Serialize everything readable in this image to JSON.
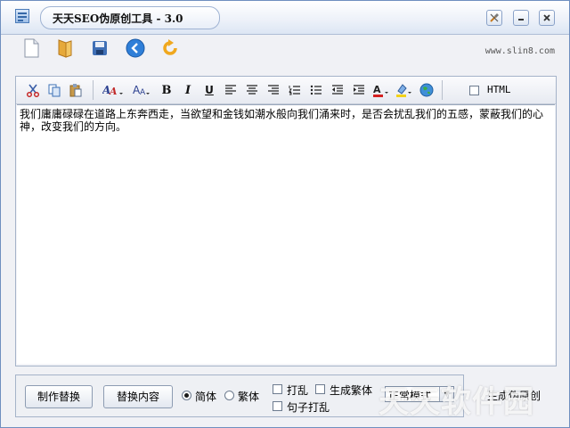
{
  "window": {
    "title": "天天SEO伪原创工具 - 3.0",
    "controls": [
      "settings-icon",
      "minimize-icon",
      "close-icon"
    ]
  },
  "toolbar": {
    "buttons": [
      "new-file-icon",
      "open-folder-icon",
      "save-icon",
      "back-icon",
      "refresh-icon"
    ],
    "site": "www.slin8.com"
  },
  "format_toolbar": {
    "buttons": [
      "cut-icon",
      "copy-icon",
      "paste-icon",
      "font-name-icon",
      "font-size-icon",
      "bold-icon",
      "italic-icon",
      "underline-icon",
      "align-left-icon",
      "align-center-icon",
      "align-right-icon",
      "ordered-list-icon",
      "bullet-list-icon",
      "outdent-icon",
      "indent-icon",
      "font-color-icon",
      "highlight-icon",
      "globe-link-icon"
    ],
    "bold": "B",
    "italic": "I",
    "underline": "U",
    "html_label": "HTML",
    "html_checked": false
  },
  "editor": {
    "content": "我们庸庸碌碌在道路上东奔西走，当欲望和金钱如潮水般向我们涌来时，是否会扰乱我们的五感，蒙蔽我们的心神，改变我们的方向。"
  },
  "bottom": {
    "make_replace": "制作替换",
    "replace_content": "替换内容",
    "simplified": "简体",
    "traditional": "繁体",
    "simplified_selected": true,
    "shuffle": "打乱",
    "generate_traditional": "生成繁体",
    "sentence_shuffle": "句子打乱",
    "mode": "正常模式",
    "generate": "生成伪原创",
    "watermark": "天天软件园"
  },
  "colors": {
    "accent": "#3568a8",
    "frame": "#a5b3c9"
  }
}
